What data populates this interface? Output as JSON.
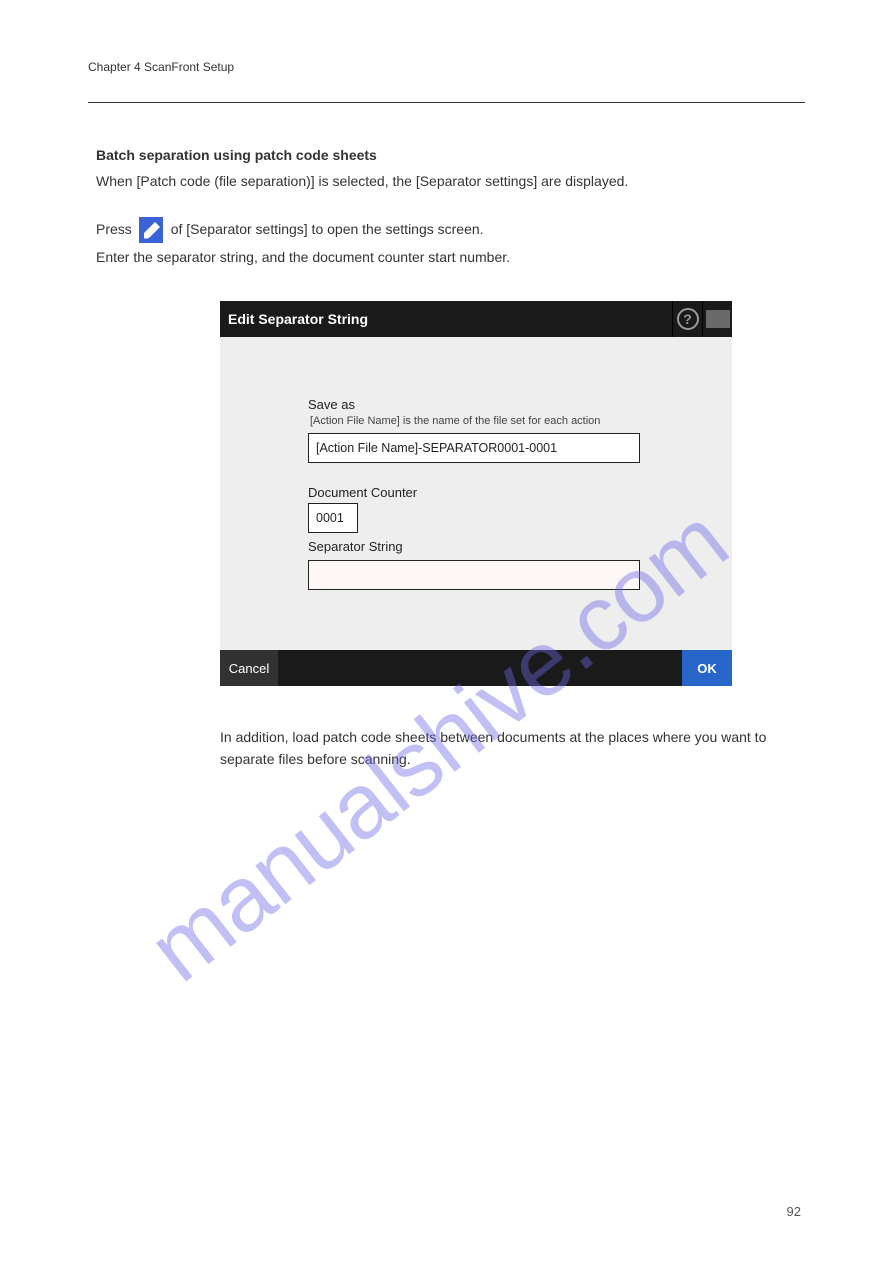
{
  "header": "Chapter 4 ScanFront Setup",
  "section_title": "Batch separation using patch code sheets",
  "intro": "When [Patch code (file separation)] is selected, the [Separator settings] are displayed.",
  "edit_line_prefix": "Press",
  "edit_line_suffix": " of [Separator settings] to open the settings screen.",
  "edit_icon_name": "edit-icon",
  "note_line": "Enter the separator string, and the document counter start number.",
  "dialog": {
    "title": "Edit Separator String",
    "save_as_label": "Save as",
    "save_as_sublabel": "[Action File Name] is the name of the file set for each action",
    "save_as_value": "[Action File Name]-SEPARATOR0001-0001",
    "doc_counter_label": "Document Counter",
    "doc_counter_value": "0001",
    "sep_string_label": "Separator String",
    "sep_string_value": "",
    "cancel_label": "Cancel",
    "ok_label": "OK"
  },
  "after_text": "In addition, load patch code sheets between documents at the places where you want to separate files before scanning.",
  "page_number": "92",
  "watermark": "manualshive.com"
}
